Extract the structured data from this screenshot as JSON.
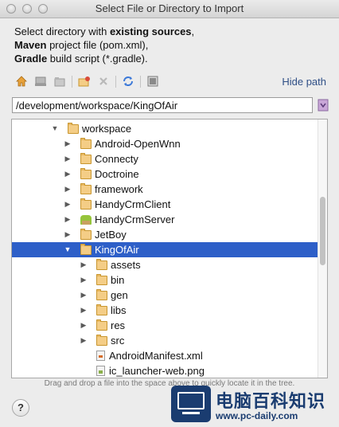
{
  "window": {
    "title": "Select File or Directory to Import"
  },
  "description": {
    "line1_prefix": "Select directory with ",
    "line1_bold": "existing sources",
    "line1_suffix": ",",
    "line2_bold": "Maven",
    "line2_rest": " project file (pom.xml),",
    "line3_bold": "Gradle",
    "line3_rest": " build script (*.gradle)."
  },
  "toolbar": {
    "icons": [
      "home-icon",
      "desktop-icon",
      "project-folder-icon",
      "new-folder-icon",
      "delete-icon",
      "refresh-icon",
      "show-hidden-icon"
    ],
    "hide_path_label": "Hide path"
  },
  "path": {
    "value": "/development/workspace/KingOfAir"
  },
  "tree": {
    "rows": [
      {
        "label": "workspace",
        "expanded": true,
        "icon": "folder-icon"
      },
      {
        "label": "Android-OpenWnn",
        "expanded": false,
        "icon": "folder-icon"
      },
      {
        "label": "Connecty",
        "expanded": false,
        "icon": "folder-icon"
      },
      {
        "label": "Doctroine",
        "expanded": false,
        "icon": "folder-icon"
      },
      {
        "label": "framework",
        "expanded": false,
        "icon": "folder-icon"
      },
      {
        "label": "HandyCrmClient",
        "expanded": false,
        "icon": "folder-icon"
      },
      {
        "label": "HandyCrmServer",
        "expanded": false,
        "icon": "android-module-icon"
      },
      {
        "label": "JetBoy",
        "expanded": false,
        "icon": "folder-icon"
      },
      {
        "label": "KingOfAir",
        "expanded": true,
        "icon": "folder-icon",
        "selected": true
      },
      {
        "label": "assets",
        "expanded": false,
        "icon": "folder-icon"
      },
      {
        "label": "bin",
        "expanded": false,
        "icon": "folder-icon"
      },
      {
        "label": "gen",
        "expanded": false,
        "icon": "folder-icon"
      },
      {
        "label": "libs",
        "expanded": false,
        "icon": "folder-icon"
      },
      {
        "label": "res",
        "expanded": false,
        "icon": "folder-icon"
      },
      {
        "label": "src",
        "expanded": false,
        "icon": "folder-icon"
      },
      {
        "label": "AndroidManifest.xml",
        "icon": "xml-file-icon"
      },
      {
        "label": "ic_launcher-web.png",
        "icon": "png-file-icon"
      }
    ]
  },
  "hint": "Drag and drop a file into the space above to quickly locate it in the tree.",
  "help_label": "?",
  "watermark": {
    "text": "电脑百科知识",
    "url": "www.pc-daily.com"
  },
  "colors": {
    "selection": "#2d5fc8",
    "link": "#2f4f86",
    "folder": "#f4cd86"
  }
}
